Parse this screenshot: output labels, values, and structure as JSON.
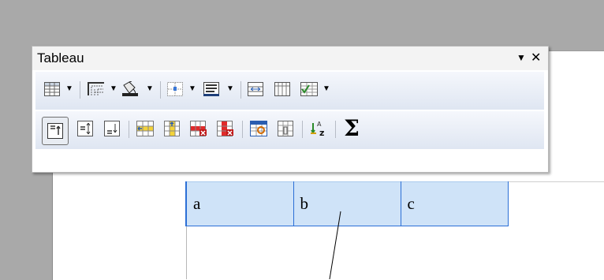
{
  "palette": {
    "title": "Tableau",
    "menu_glyph": "▼",
    "close_glyph": "✕"
  },
  "toolbar_row1": [
    {
      "name": "insert-table-icon",
      "dropdown": true
    },
    {
      "name": "borders-icon",
      "dropdown": true
    },
    {
      "name": "fill-color-icon",
      "dropdown": true
    },
    {
      "name": "cell-borders-icon",
      "dropdown": true
    },
    {
      "name": "line-style-icon",
      "dropdown": true
    },
    {
      "name": "merge-cells-icon",
      "dropdown": false
    },
    {
      "name": "split-cells-icon",
      "dropdown": false
    },
    {
      "name": "autoformat-icon",
      "dropdown": true
    }
  ],
  "toolbar_row2": [
    {
      "name": "align-top-icon",
      "pressed": true
    },
    {
      "name": "align-center-vertical-icon"
    },
    {
      "name": "align-bottom-icon"
    },
    {
      "name": "insert-row-icon"
    },
    {
      "name": "insert-column-icon"
    },
    {
      "name": "delete-row-icon"
    },
    {
      "name": "delete-column-icon"
    },
    {
      "name": "table-properties-icon"
    },
    {
      "name": "number-format-icon"
    },
    {
      "name": "sort-icon"
    },
    {
      "name": "sum-icon"
    }
  ],
  "sum_glyph": "Σ",
  "table": {
    "cells": [
      "a",
      "b",
      "c"
    ]
  },
  "colors": {
    "cell_fill": "#cfe3f8",
    "cell_border": "#2b6fd6",
    "toolbar_bg": "#dfe6f2"
  }
}
